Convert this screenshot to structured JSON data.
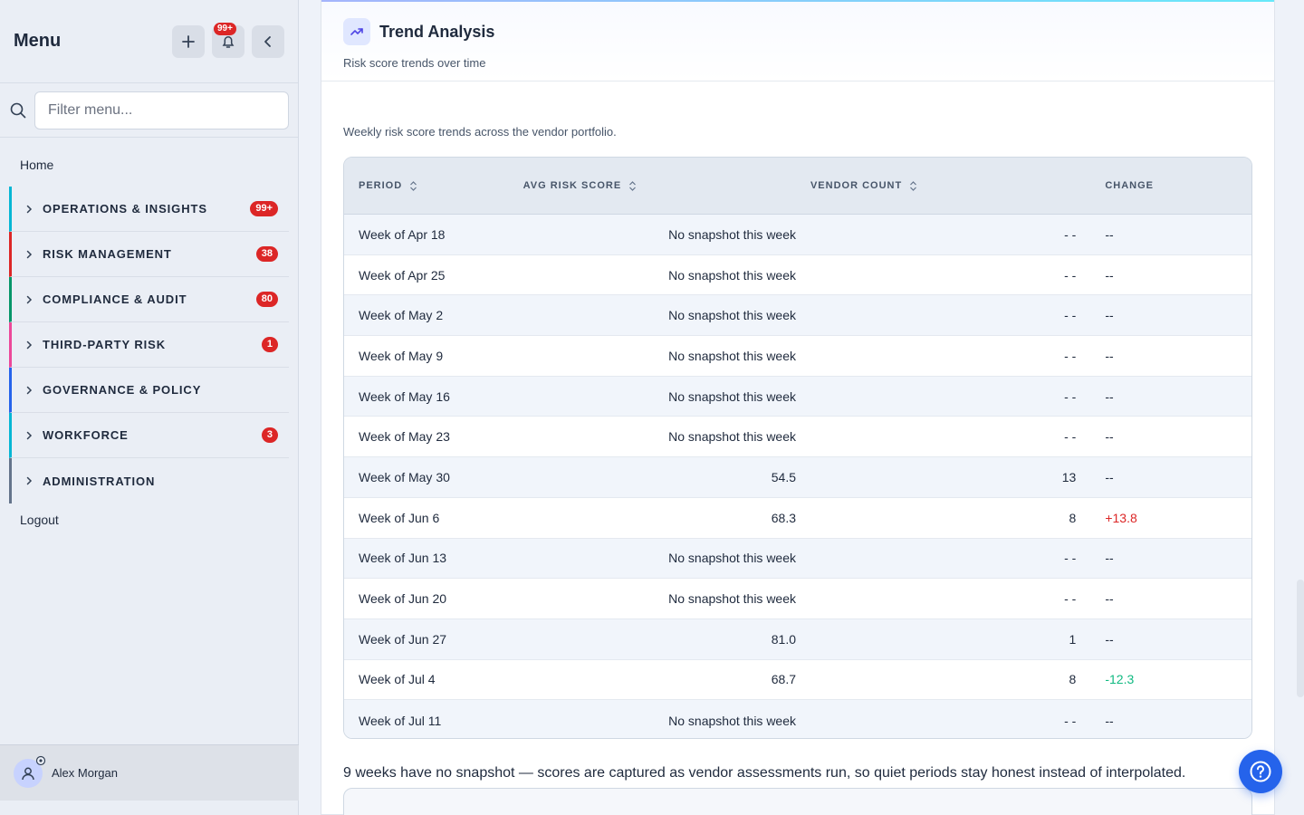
{
  "sidebar": {
    "title": "Menu",
    "notification_badge": "99+",
    "filter_placeholder": "Filter menu...",
    "home": "Home",
    "logout": "Logout",
    "groups": [
      {
        "label": "OPERATIONS & INSIGHTS",
        "badge": "99+",
        "color": "#06b6d4"
      },
      {
        "label": "RISK MANAGEMENT",
        "badge": "38",
        "color": "#dc2626"
      },
      {
        "label": "COMPLIANCE & AUDIT",
        "badge": "80",
        "color": "#059669"
      },
      {
        "label": "THIRD-PARTY RISK",
        "badge": "1",
        "color": "#ec4899"
      },
      {
        "label": "GOVERNANCE & POLICY",
        "badge": "",
        "color": "#2563eb"
      },
      {
        "label": "WORKFORCE",
        "badge": "3",
        "color": "#06b6d4"
      },
      {
        "label": "ADMINISTRATION",
        "badge": "",
        "color": "#64748b"
      }
    ],
    "user_name": "Alex Morgan"
  },
  "card": {
    "title": "Trend Analysis",
    "subtitle": "Risk score trends over time",
    "description": "Weekly risk score trends across the vendor portfolio.",
    "columns": [
      "PERIOD",
      "AVG RISK SCORE",
      "VENDOR COUNT",
      "CHANGE"
    ],
    "rows": [
      {
        "period": "Week of Apr 18",
        "avg": "No snapshot this week",
        "count": "- -",
        "change": "--",
        "tone": ""
      },
      {
        "period": "Week of Apr 25",
        "avg": "No snapshot this week",
        "count": "- -",
        "change": "--",
        "tone": ""
      },
      {
        "period": "Week of May 2",
        "avg": "No snapshot this week",
        "count": "- -",
        "change": "--",
        "tone": ""
      },
      {
        "period": "Week of May 9",
        "avg": "No snapshot this week",
        "count": "- -",
        "change": "--",
        "tone": ""
      },
      {
        "period": "Week of May 16",
        "avg": "No snapshot this week",
        "count": "- -",
        "change": "--",
        "tone": ""
      },
      {
        "period": "Week of May 23",
        "avg": "No snapshot this week",
        "count": "- -",
        "change": "--",
        "tone": ""
      },
      {
        "period": "Week of May 30",
        "avg": "54.5",
        "count": "13",
        "change": "--",
        "tone": ""
      },
      {
        "period": "Week of Jun 6",
        "avg": "68.3",
        "count": "8",
        "change": "+13.8",
        "tone": "pos"
      },
      {
        "period": "Week of Jun 13",
        "avg": "No snapshot this week",
        "count": "- -",
        "change": "--",
        "tone": ""
      },
      {
        "period": "Week of Jun 20",
        "avg": "No snapshot this week",
        "count": "- -",
        "change": "--",
        "tone": ""
      },
      {
        "period": "Week of Jun 27",
        "avg": "81.0",
        "count": "1",
        "change": "--",
        "tone": ""
      },
      {
        "period": "Week of Jul 4",
        "avg": "68.7",
        "count": "8",
        "change": "-12.3",
        "tone": "neg"
      },
      {
        "period": "Week of Jul 11",
        "avg": "No snapshot this week",
        "count": "- -",
        "change": "--",
        "tone": ""
      }
    ],
    "footnote": "9 weeks have no snapshot — scores are captured as vendor assessments run, so quiet periods stay honest instead of interpolated."
  },
  "colors": {
    "accent": "#2563eb",
    "positive_change": "#dc2626",
    "negative_change": "#10b981"
  }
}
